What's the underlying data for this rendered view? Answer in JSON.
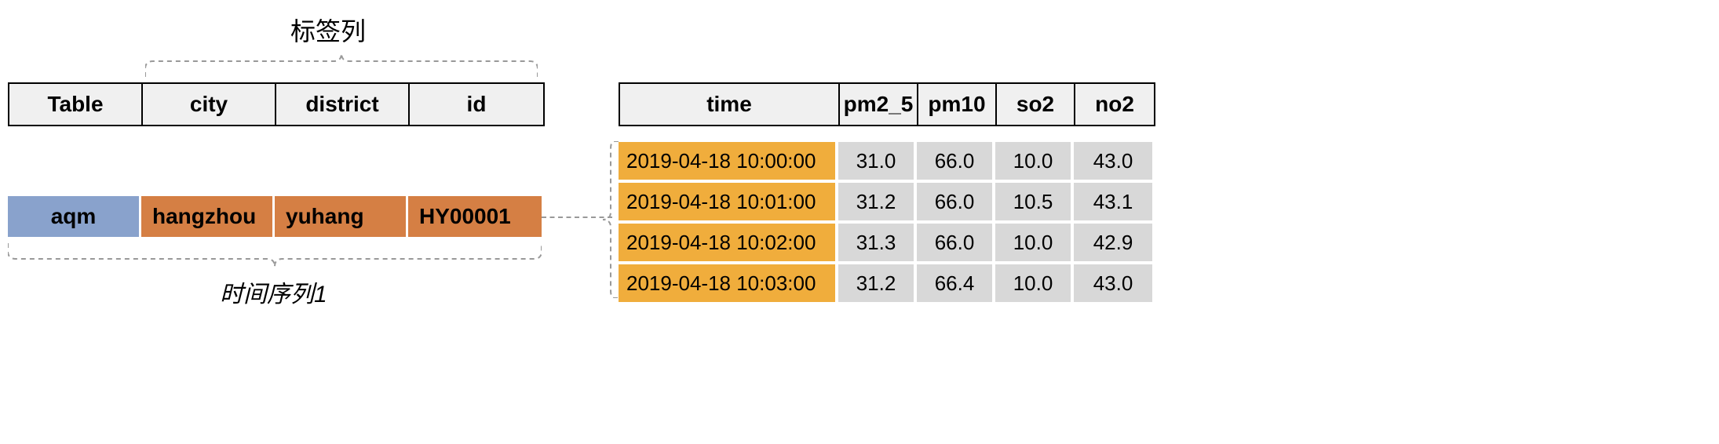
{
  "labels": {
    "tag_column": "标签列",
    "timeseries1": "时间序列1"
  },
  "left_table": {
    "headers": [
      "Table",
      "city",
      "district",
      "id"
    ],
    "row": [
      "aqm",
      "hangzhou",
      "yuhang",
      "HY00001"
    ]
  },
  "right_table": {
    "headers": [
      "time",
      "pm2_5",
      "pm10",
      "so2",
      "no2"
    ],
    "rows": [
      {
        "time": "2019-04-18 10:00:00",
        "pm2_5": "31.0",
        "pm10": "66.0",
        "so2": "10.0",
        "no2": "43.0"
      },
      {
        "time": "2019-04-18 10:01:00",
        "pm2_5": "31.2",
        "pm10": "66.0",
        "so2": "10.5",
        "no2": "43.1"
      },
      {
        "time": "2019-04-18 10:02:00",
        "pm2_5": "31.3",
        "pm10": "66.0",
        "so2": "10.0",
        "no2": "42.9"
      },
      {
        "time": "2019-04-18 10:03:00",
        "pm2_5": "31.2",
        "pm10": "66.4",
        "so2": "10.0",
        "no2": "43.0"
      }
    ]
  },
  "colors": {
    "blue": "#89a2cc",
    "orange": "#d57f44",
    "yellow": "#f0ad3c",
    "grey": "#d8d8d8",
    "header_bg": "#f0f0f0"
  }
}
